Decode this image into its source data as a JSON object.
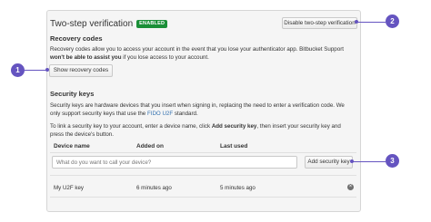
{
  "header": {
    "title": "Two-step verification",
    "badge": "ENABLED",
    "disable_button": "Disable two-step verification"
  },
  "recovery": {
    "heading": "Recovery codes",
    "text_1": "Recovery codes allow you to access your account in the event that you lose your authenticator app. Bitbucket Support ",
    "text_bold": "won't be able to assist you",
    "text_2": " if you lose access to your account.",
    "show_button": "Show recovery codes"
  },
  "security_keys": {
    "heading": "Security keys",
    "desc_1": "Security keys are hardware devices that you insert when signing in, replacing the need to enter a verification code. We only support security keys that use the ",
    "desc_link": "FIDO U2F",
    "desc_2": " standard.",
    "instr_1": "To link a security key to your account, enter a device name, click ",
    "instr_bold": "Add security key",
    "instr_2": ", then insert your security key and press the device's button.",
    "columns": [
      "Device name",
      "Added on",
      "Last used"
    ],
    "input_placeholder": "What do you want to call your device?",
    "add_button": "Add security key",
    "rows": [
      {
        "device": "My U2F key",
        "added": "6 minutes ago",
        "last_used": "5 minutes ago"
      }
    ]
  },
  "callouts": [
    "1",
    "2",
    "3"
  ],
  "colors": {
    "callout": "#6554c0",
    "badge": "#1a8f37",
    "link": "#3572b0"
  }
}
